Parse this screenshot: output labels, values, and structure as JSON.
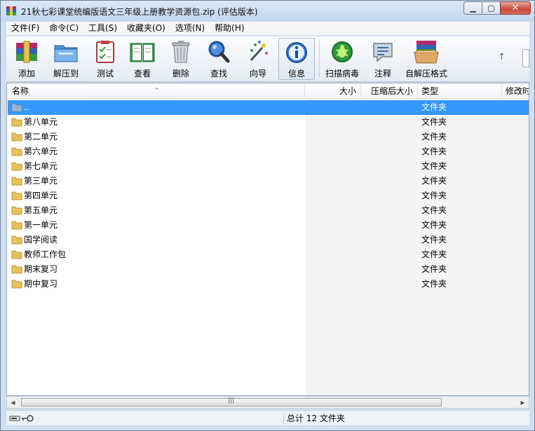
{
  "window": {
    "title": "21秋七彩课堂统编版语文三年级上册教学资源包.zip (评估版本)"
  },
  "menu": [
    "文件(F)",
    "命令(C)",
    "工具(S)",
    "收藏夹(O)",
    "选项(N)",
    "帮助(H)"
  ],
  "toolbar": {
    "add": "添加",
    "extract": "解压到",
    "test": "测试",
    "view": "查看",
    "delete": "删除",
    "find": "查找",
    "wizard": "向导",
    "info": "信息",
    "virus": "扫描病毒",
    "comment": "注释",
    "sfx": "自解压格式"
  },
  "columns": {
    "name": "名称",
    "size": "大小",
    "packed": "压缩后大小",
    "type": "类型",
    "modified": "修改时"
  },
  "rows": [
    {
      "name": "..",
      "type": "文件夹"
    },
    {
      "name": "第八单元",
      "type": "文件夹"
    },
    {
      "name": "第二单元",
      "type": "文件夹"
    },
    {
      "name": "第六单元",
      "type": "文件夹"
    },
    {
      "name": "第七单元",
      "type": "文件夹"
    },
    {
      "name": "第三单元",
      "type": "文件夹"
    },
    {
      "name": "第四单元",
      "type": "文件夹"
    },
    {
      "name": "第五单元",
      "type": "文件夹"
    },
    {
      "name": "第一单元",
      "type": "文件夹"
    },
    {
      "name": "国学阅读",
      "type": "文件夹"
    },
    {
      "name": "教师工作包",
      "type": "文件夹"
    },
    {
      "name": "期末复习",
      "type": "文件夹"
    },
    {
      "name": "期中复习",
      "type": "文件夹"
    }
  ],
  "status": {
    "summary": "总计 12 文件夹"
  }
}
